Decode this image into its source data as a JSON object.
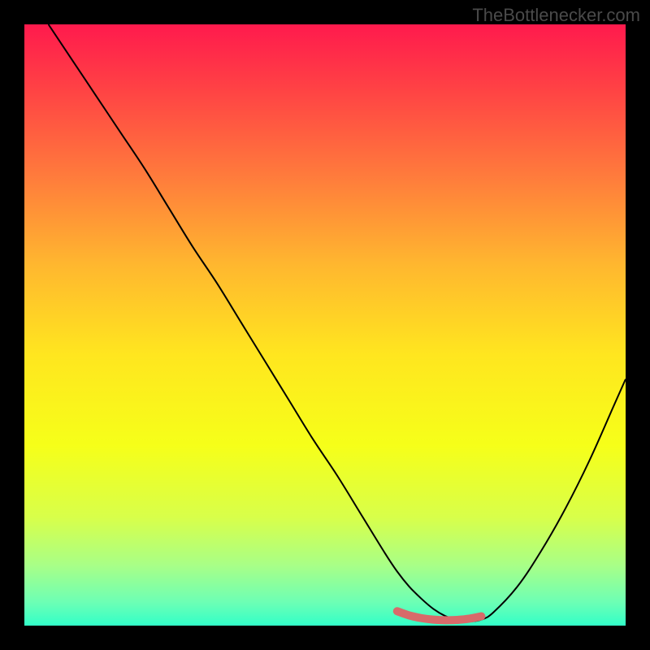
{
  "watermark": "TheBottlenecker.com",
  "chart_data": {
    "type": "line",
    "title": "",
    "xlabel": "",
    "ylabel": "",
    "xlim": [
      0,
      100
    ],
    "ylim": [
      0,
      100
    ],
    "background_gradient": {
      "stops": [
        {
          "offset": 0.0,
          "color": "#ff1a4d"
        },
        {
          "offset": 0.1,
          "color": "#ff3f45"
        },
        {
          "offset": 0.25,
          "color": "#ff7a3c"
        },
        {
          "offset": 0.4,
          "color": "#ffb72f"
        },
        {
          "offset": 0.55,
          "color": "#ffe61f"
        },
        {
          "offset": 0.7,
          "color": "#f6ff19"
        },
        {
          "offset": 0.82,
          "color": "#d8ff4a"
        },
        {
          "offset": 0.9,
          "color": "#a8ff87"
        },
        {
          "offset": 0.96,
          "color": "#6effb4"
        },
        {
          "offset": 1.0,
          "color": "#32ffc8"
        }
      ]
    },
    "series": [
      {
        "name": "bottleneck-curve",
        "color": "#000000",
        "width": 2,
        "x": [
          4,
          8,
          12,
          16,
          20,
          24,
          28,
          32,
          36,
          40,
          44,
          48,
          52,
          56,
          60,
          62,
          64,
          66,
          68,
          70,
          72,
          74,
          76,
          78,
          82,
          86,
          90,
          94,
          98,
          100
        ],
        "y": [
          100,
          94,
          88,
          82,
          76,
          69.5,
          63,
          57,
          50.5,
          44,
          37.5,
          31,
          25,
          18.5,
          12,
          9,
          6.5,
          4.5,
          2.8,
          1.6,
          0.9,
          0.7,
          1.0,
          2.2,
          6.5,
          12.5,
          19.5,
          27.5,
          36.5,
          41
        ]
      },
      {
        "name": "optimal-segment",
        "color": "#d86a6a",
        "width": 10,
        "linecap": "round",
        "x": [
          62,
          64,
          66,
          68,
          70,
          72,
          74,
          76
        ],
        "y": [
          2.4,
          1.7,
          1.25,
          1.0,
          0.9,
          0.95,
          1.15,
          1.55
        ]
      }
    ]
  }
}
